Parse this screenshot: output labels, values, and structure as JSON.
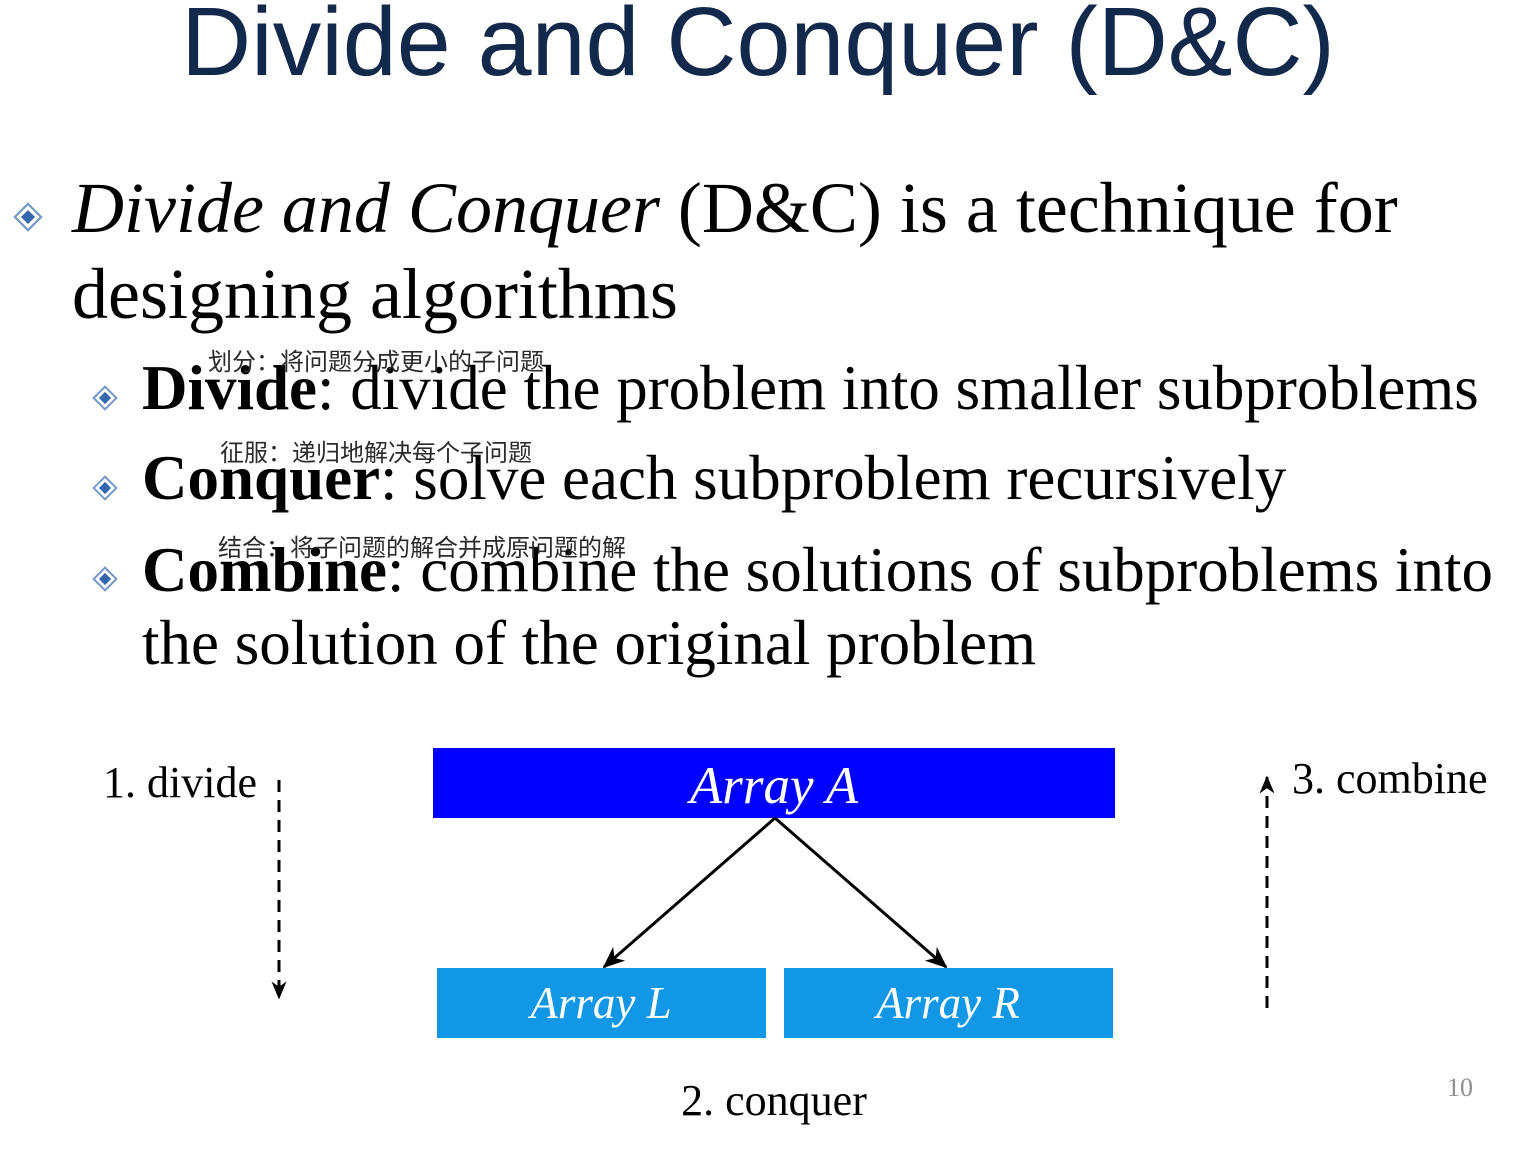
{
  "slide": {
    "title": "Divide and Conquer (D&C)",
    "page_number": "10"
  },
  "bullets": [
    {
      "icon": "diamond-bullet-icon",
      "italic_term": "Divide and Conquer",
      "text": " (D&C) is a technique for",
      "continuation": "designing algorithms",
      "sub_bullets": [
        {
          "icon": "diamond-bullet-icon",
          "term": "Divide",
          "text": ": divide the problem into smaller subproblems",
          "annotation": "划分：将问题分成更小的子问题"
        },
        {
          "icon": "diamond-bullet-icon",
          "term": "Conquer",
          "text": ": solve each subproblem recursively",
          "annotation": "征服：递归地解决每个子问题"
        },
        {
          "icon": "diamond-bullet-icon",
          "term": "Combine",
          "text": ": combine the solutions of subproblems into",
          "continuation": "the solution of the original problem",
          "annotation": "结合：将子问题的解合并成原问题的解"
        }
      ]
    }
  ],
  "diagram": {
    "array_a": "Array A",
    "array_l": "Array L",
    "array_r": "Array R",
    "step_divide": "1. divide",
    "step_conquer": "2. conquer",
    "step_combine": "3. combine"
  },
  "colors": {
    "title": "#13294b",
    "array_a_fill": "#0000ff",
    "array_lr_fill": "#1296e6",
    "bullet_outer": "#7599c5",
    "bullet_inner": "#3467ae",
    "page_number": "#8f8f8f"
  }
}
